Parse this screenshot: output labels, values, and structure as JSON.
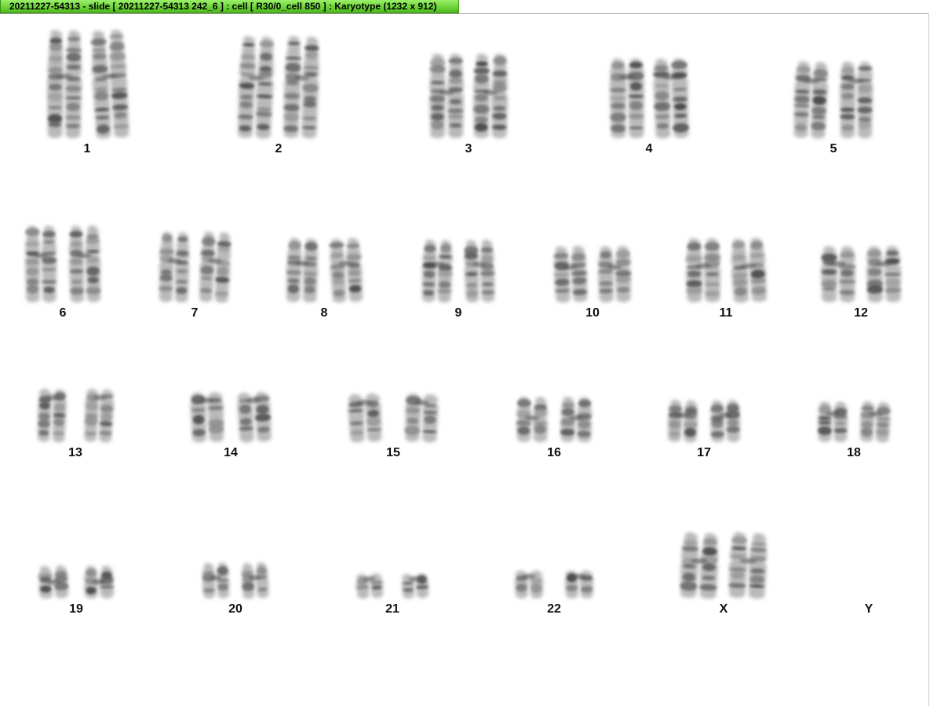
{
  "window": {
    "title": "20211227-54313 - slide [ 20211227-54313 242_6 ] : cell [ R30/0_cell 850 ] : Karyotype  (1232 x 912)"
  },
  "karyotype": {
    "chromosomes": [
      {
        "label": "1",
        "count": 2
      },
      {
        "label": "2",
        "count": 2
      },
      {
        "label": "3",
        "count": 2
      },
      {
        "label": "4",
        "count": 2
      },
      {
        "label": "5",
        "count": 2
      },
      {
        "label": "6",
        "count": 2
      },
      {
        "label": "7",
        "count": 2
      },
      {
        "label": "8",
        "count": 2
      },
      {
        "label": "9",
        "count": 2
      },
      {
        "label": "10",
        "count": 2
      },
      {
        "label": "11",
        "count": 2
      },
      {
        "label": "12",
        "count": 2
      },
      {
        "label": "13",
        "count": 2
      },
      {
        "label": "14",
        "count": 2
      },
      {
        "label": "15",
        "count": 2
      },
      {
        "label": "16",
        "count": 2
      },
      {
        "label": "17",
        "count": 2
      },
      {
        "label": "18",
        "count": 2
      },
      {
        "label": "19",
        "count": 2
      },
      {
        "label": "20",
        "count": 2
      },
      {
        "label": "21",
        "count": 2
      },
      {
        "label": "22",
        "count": 2
      },
      {
        "label": "X",
        "count": 2
      },
      {
        "label": "Y",
        "count": 0
      }
    ]
  },
  "colors": {
    "title_bar": "#6fd43a",
    "chromosome_stain": "#555555",
    "label": "#111111"
  }
}
